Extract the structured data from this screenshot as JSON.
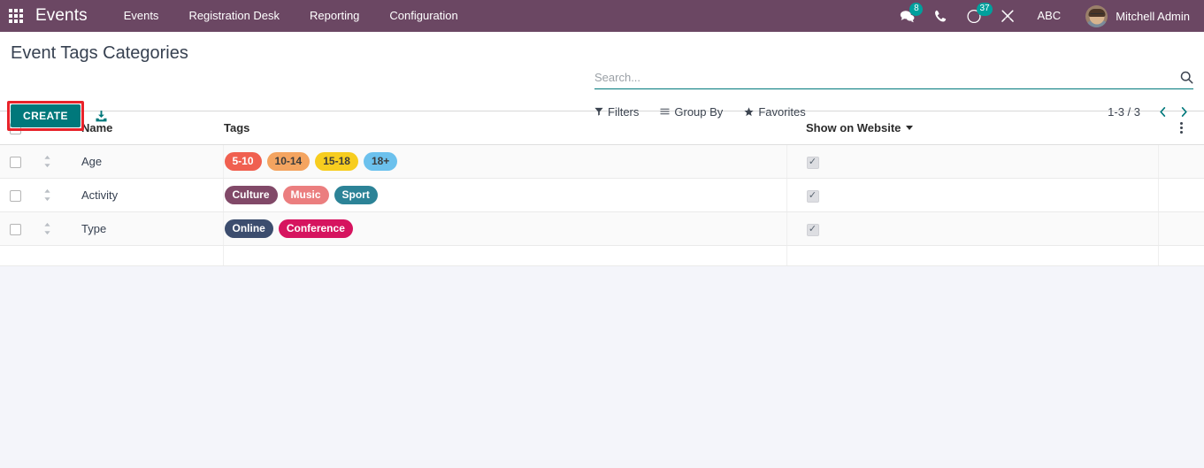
{
  "navbar": {
    "apps_icon": "apps-grid-icon",
    "brand": "Events",
    "menu": [
      {
        "label": "Events"
      },
      {
        "label": "Registration Desk"
      },
      {
        "label": "Reporting"
      },
      {
        "label": "Configuration"
      }
    ],
    "systray": {
      "messages_icon": "chat-icon",
      "messages_count": "8",
      "phone_icon": "phone-icon",
      "activities_icon": "clock-icon",
      "activities_count": "37",
      "debug_icon": "wrench-icon",
      "language": "ABC",
      "avatar_icon": "user-avatar",
      "user_name": "Mitchell Admin"
    }
  },
  "control_panel": {
    "title": "Event Tags Categories",
    "create_label": "CREATE",
    "import_icon": "import-download-icon",
    "search": {
      "placeholder": "Search...",
      "value": "",
      "search_icon": "search-icon"
    },
    "filters": [
      {
        "label": "Filters",
        "icon": "funnel-icon"
      },
      {
        "label": "Group By",
        "icon": "list-lines-icon"
      },
      {
        "label": "Favorites",
        "icon": "star-icon"
      }
    ],
    "pager": {
      "range": "1-3 / 3",
      "prev_icon": "chevron-left-icon",
      "next_icon": "chevron-right-icon"
    }
  },
  "list": {
    "columns": {
      "select_all": "select-all-checkbox",
      "name": "Name",
      "tags": "Tags",
      "show_on_website": "Show on Website",
      "options_icon": "options-dots-icon"
    },
    "rows": [
      {
        "name": "Age",
        "show_on_website": true,
        "tags": [
          {
            "label": "5-10",
            "bg": "#F06050",
            "fg": "#FFFFFF"
          },
          {
            "label": "10-14",
            "bg": "#F4A460",
            "fg": "#3C3C3C"
          },
          {
            "label": "15-18",
            "bg": "#F7CD1F",
            "fg": "#3C3C3C"
          },
          {
            "label": "18+",
            "bg": "#6CC1ED",
            "fg": "#3C3C3C"
          }
        ]
      },
      {
        "name": "Activity",
        "show_on_website": true,
        "tags": [
          {
            "label": "Culture",
            "bg": "#814968",
            "fg": "#FFFFFF"
          },
          {
            "label": "Music",
            "bg": "#EB7E7F",
            "fg": "#FFFFFF"
          },
          {
            "label": "Sport",
            "bg": "#2C8397",
            "fg": "#FFFFFF"
          }
        ]
      },
      {
        "name": "Type",
        "show_on_website": true,
        "tags": [
          {
            "label": "Online",
            "bg": "#3C4D6E",
            "fg": "#FFFFFF"
          },
          {
            "label": "Conference",
            "bg": "#D6145F",
            "fg": "#FFFFFF"
          }
        ]
      }
    ]
  },
  "theme": {
    "navbar_bg": "#6B4763",
    "primary": "#00787B",
    "badge": "#00A09D",
    "highlight": "#E8232A",
    "page_bg": "#F4F5FA"
  }
}
